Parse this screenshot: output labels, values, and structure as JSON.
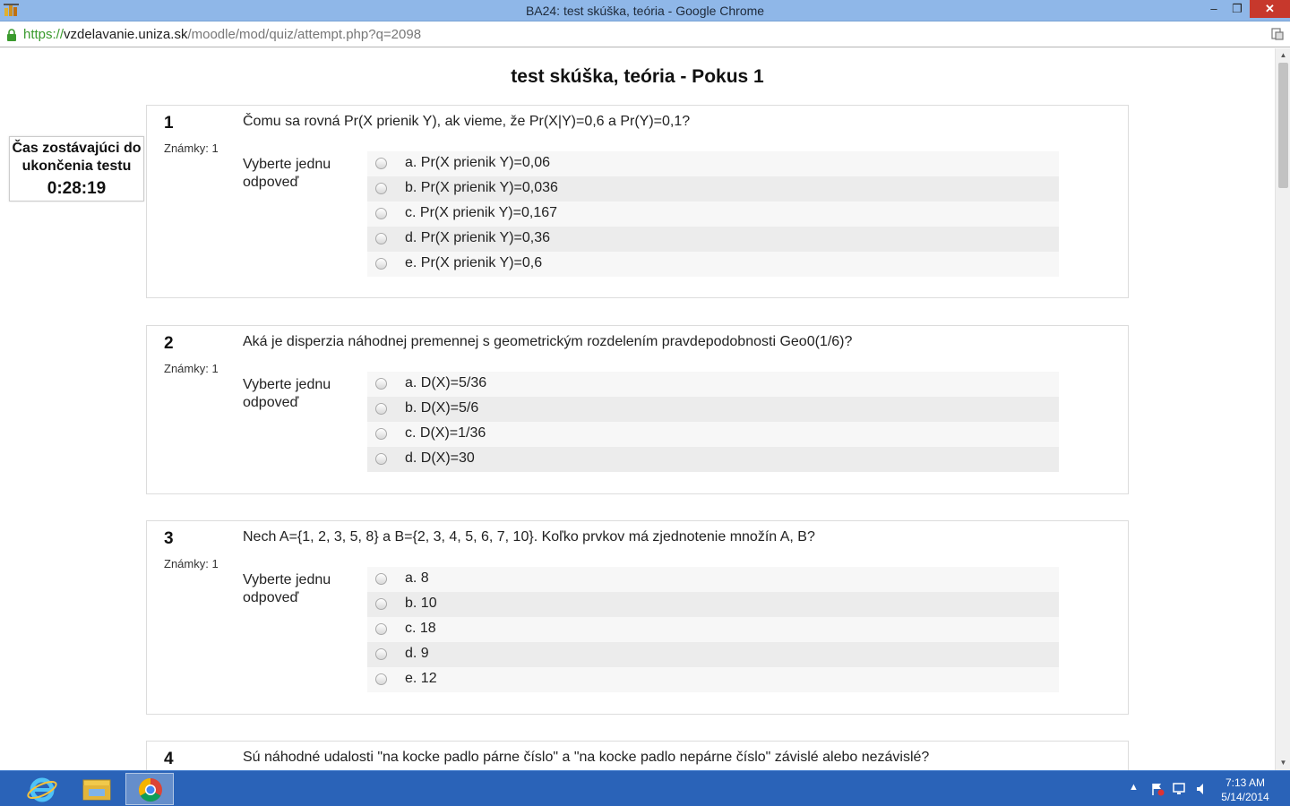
{
  "window": {
    "title": "BA24: test skúška, teória - Google Chrome",
    "minimize": "–",
    "maximize": "❐",
    "close": "✕"
  },
  "address": {
    "scheme": "https://",
    "host": "vzdelavanie.uniza.sk",
    "path": "/moodle/mod/quiz/attempt.php?q=2098"
  },
  "page": {
    "title": "test skúška, teória - Pokus 1"
  },
  "timer": {
    "label": "Čas zostávajúci do ukončenia testu",
    "value": "0:28:19"
  },
  "prompt": "Vyberte jednu odpoveď",
  "questions": [
    {
      "number": "1",
      "marks": "Známky: 1",
      "text": "Čomu sa rovná Pr(X prienik Y), ak vieme, že Pr(X|Y)=0,6 a Pr(Y)=0,1?",
      "answers": [
        "a. Pr(X prienik Y)=0,06",
        "b. Pr(X prienik Y)=0,036",
        "c. Pr(X prienik Y)=0,167",
        "d. Pr(X prienik Y)=0,36",
        "e. Pr(X prienik Y)=0,6"
      ]
    },
    {
      "number": "2",
      "marks": "Známky: 1",
      "text": "Aká je disperzia náhodnej premennej s geometrickým rozdelením pravdepodobnosti Geo0(1/6)?",
      "answers": [
        "a. D(X)=5/36",
        "b. D(X)=5/6",
        "c. D(X)=1/36",
        "d. D(X)=30"
      ]
    },
    {
      "number": "3",
      "marks": "Známky: 1",
      "text": "Nech A={1, 2, 3, 5, 8} a B={2, 3, 4, 5, 6, 7, 10}. Koľko prvkov má zjednotenie množín A, B?",
      "answers": [
        "a. 8",
        "b. 10",
        "c. 18",
        "d. 9",
        "e. 12"
      ]
    },
    {
      "number": "4",
      "text": "Sú náhodné udalosti \"na kocke padlo párne číslo\" a \"na kocke padlo nepárne číslo\" závislé alebo nezávislé?"
    }
  ],
  "taskbar": {
    "clock_time": "7:13 AM",
    "clock_date": "5/14/2014"
  }
}
